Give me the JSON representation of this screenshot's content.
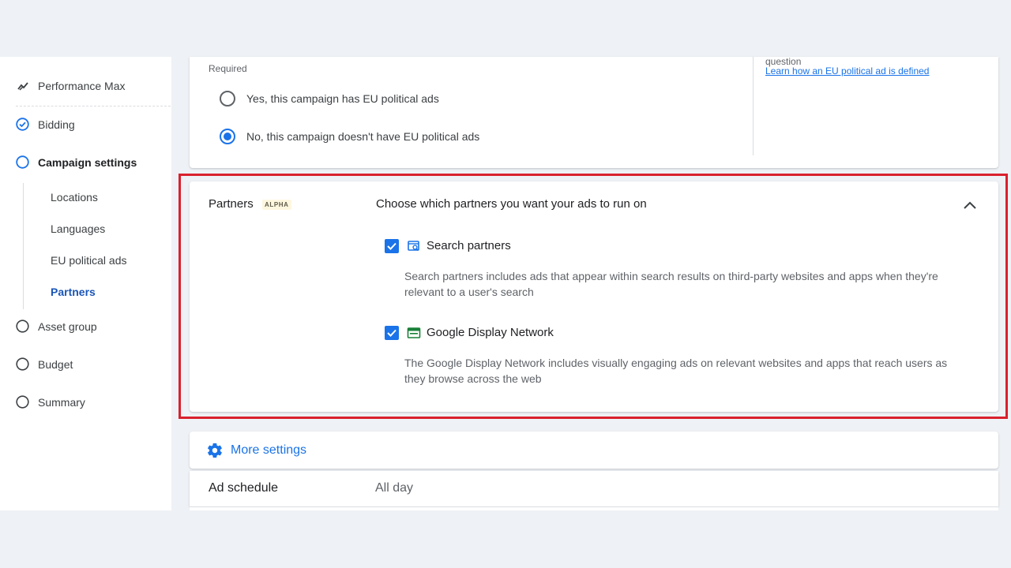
{
  "sidebar": {
    "items": [
      {
        "label": "Performance Max",
        "icon": "performance-trend-icon"
      },
      {
        "label": "Bidding",
        "icon": "check-circle-icon",
        "state": "complete"
      },
      {
        "label": "Campaign settings",
        "icon": "circle-icon",
        "state": "active"
      },
      {
        "label": "Asset group",
        "icon": "circle-icon"
      },
      {
        "label": "Budget",
        "icon": "circle-icon"
      },
      {
        "label": "Summary",
        "icon": "circle-icon"
      }
    ],
    "sub_items": [
      {
        "label": "Locations"
      },
      {
        "label": "Languages"
      },
      {
        "label": "EU political ads"
      },
      {
        "label": "Partners",
        "active": true
      }
    ]
  },
  "eu_political": {
    "required_label": "Required",
    "options": [
      {
        "label": "Yes, this campaign has EU political ads",
        "selected": false
      },
      {
        "label": "No, this campaign doesn't have EU political ads",
        "selected": true
      }
    ],
    "help_text": "question",
    "help_link": "Learn how an EU political ad is defined"
  },
  "partners": {
    "title": "Partners",
    "badge": "ALPHA",
    "description": "Choose which partners you want your ads to run on",
    "options": [
      {
        "label": "Search partners",
        "checked": true,
        "icon": "search-partners-icon",
        "description": "Search partners includes ads that appear within search results on third-party websites and apps when they're relevant to a user's search"
      },
      {
        "label": "Google Display Network",
        "checked": true,
        "icon": "display-network-icon",
        "description": "The Google Display Network includes visually engaging ads on relevant websites and apps that reach users as they browse across the web"
      }
    ]
  },
  "more_settings": {
    "label": "More settings",
    "icon": "gear-icon"
  },
  "ad_schedule": {
    "label": "Ad schedule",
    "value": "All day"
  },
  "colors": {
    "accent": "#1a73e8",
    "highlight": "#d9202c",
    "background": "#eef1f5"
  }
}
